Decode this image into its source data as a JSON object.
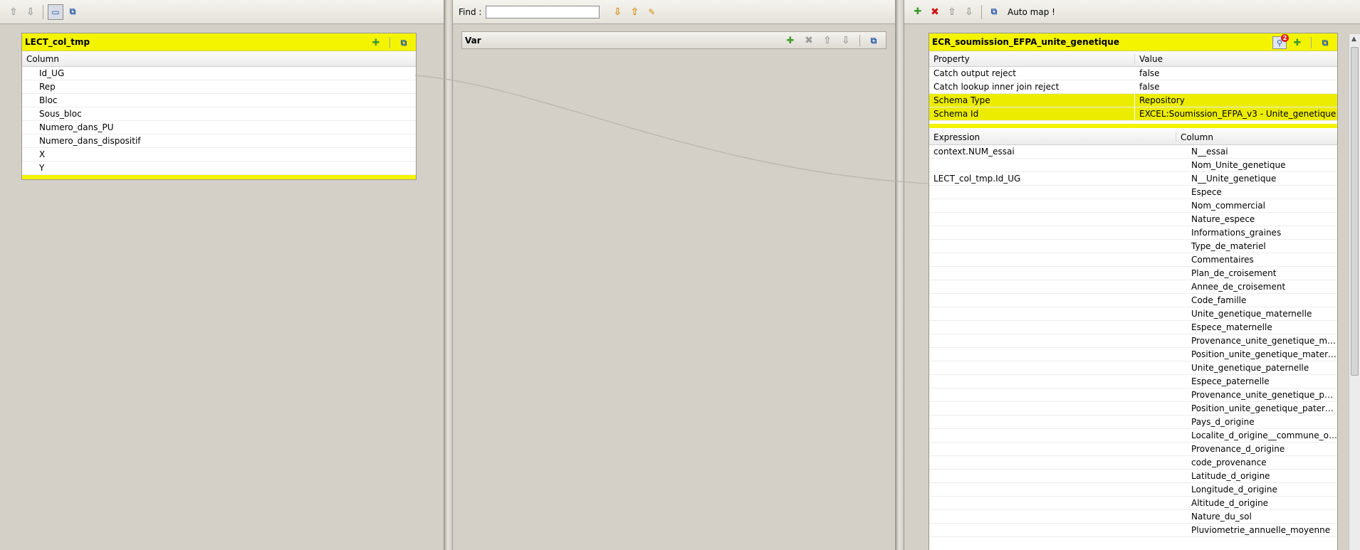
{
  "left_pane": {
    "table": {
      "title": "LECT_col_tmp",
      "column_header": "Column",
      "rows": [
        "Id_UG",
        "Rep",
        "Bloc",
        "Sous_bloc",
        "Numero_dans_PU",
        "Numero_dans_dispositif",
        "X",
        "Y"
      ]
    }
  },
  "middle_pane": {
    "find_label": "Find :",
    "find_value": "",
    "var_title": "Var"
  },
  "right_pane": {
    "auto_map_label": "Auto map !",
    "table": {
      "title": "ECR_soumission_EFPA_unite_genetique",
      "badge_count": "2",
      "property_header": "Property",
      "value_header": "Value",
      "properties": [
        {
          "property": "Catch output reject",
          "value": "false"
        },
        {
          "property": "Catch lookup inner join reject",
          "value": "false"
        },
        {
          "property": "Schema Type",
          "value": "Repository"
        },
        {
          "property": "Schema Id",
          "value": "EXCEL:Soumission_EFPA_v3 - Unite_genetique"
        }
      ],
      "expression_header": "Expression",
      "column_header": "Column",
      "rows": [
        {
          "expression": "context.NUM_essai",
          "column": "N__essai"
        },
        {
          "expression": "",
          "column": "Nom_Unite_genetique"
        },
        {
          "expression": "LECT_col_tmp.Id_UG",
          "column": "N__Unite_genetique"
        },
        {
          "expression": "",
          "column": "Espece"
        },
        {
          "expression": "",
          "column": "Nom_commercial"
        },
        {
          "expression": "",
          "column": "Nature_espece"
        },
        {
          "expression": "",
          "column": "Informations_graines"
        },
        {
          "expression": "",
          "column": "Type_de_materiel"
        },
        {
          "expression": "",
          "column": "Commentaires"
        },
        {
          "expression": "",
          "column": "Plan_de_croisement"
        },
        {
          "expression": "",
          "column": "Annee_de_croisement"
        },
        {
          "expression": "",
          "column": "Code_famille"
        },
        {
          "expression": "",
          "column": "Unite_genetique_maternelle"
        },
        {
          "expression": "",
          "column": "Espece_maternelle"
        },
        {
          "expression": "",
          "column": "Provenance_unite_genetique_mater..."
        },
        {
          "expression": "",
          "column": "Position_unite_genetique_maternelle"
        },
        {
          "expression": "",
          "column": "Unite_genetique_paternelle"
        },
        {
          "expression": "",
          "column": "Espece_paternelle"
        },
        {
          "expression": "",
          "column": "Provenance_unite_genetique_pater..."
        },
        {
          "expression": "",
          "column": "Position_unite_genetique_paternelle"
        },
        {
          "expression": "",
          "column": "Pays_d_origine"
        },
        {
          "expression": "",
          "column": "Localite_d_origine__commune_ou_..."
        },
        {
          "expression": "",
          "column": "Provenance_d_origine"
        },
        {
          "expression": "",
          "column": "code_provenance"
        },
        {
          "expression": "",
          "column": "Latitude_d_origine"
        },
        {
          "expression": "",
          "column": "Longitude_d_origine"
        },
        {
          "expression": "",
          "column": "Altitude_d_origine"
        },
        {
          "expression": "",
          "column": "Nature_du_sol"
        },
        {
          "expression": "",
          "column": "Pluviometrie_annuelle_moyenne"
        }
      ]
    }
  },
  "icons": {
    "up": "arrow-up-icon",
    "down": "arrow-down-icon",
    "add": "add-icon",
    "remove": "remove-icon",
    "minimize": "minimize-icon",
    "auto_map": "auto-map-icon"
  },
  "colors": {
    "pane_bg": "#d4d0c8",
    "header_yellow": "#f4f400",
    "link_line": "#b8b4aa"
  }
}
